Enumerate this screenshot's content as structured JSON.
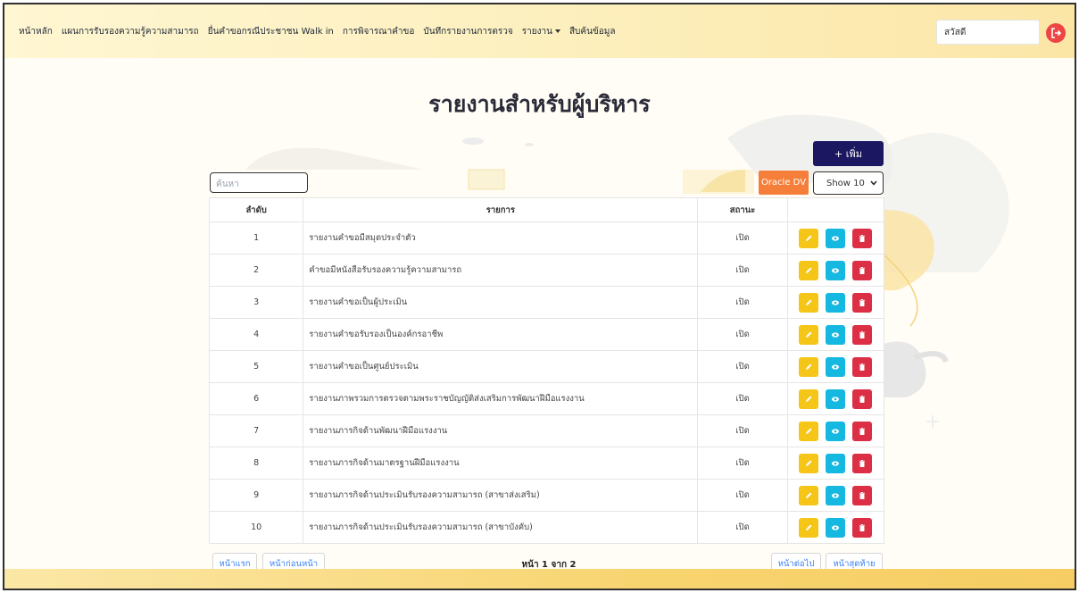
{
  "nav": {
    "items": [
      {
        "label": "หน้าหลัก"
      },
      {
        "label": "แผนการรับรองความรู้ความสามารถ"
      },
      {
        "label": "ยื่นคำขอกรณีประชาชน Walk in"
      },
      {
        "label": "การพิจารณาคำขอ"
      },
      {
        "label": "บันทึกรายงานการตรวจ"
      },
      {
        "label": "รายงาน"
      },
      {
        "label": "สืบค้นข้อมูล"
      }
    ],
    "greeting": "สวัสดี",
    "logout_icon": "logout-icon"
  },
  "page": {
    "title": "รายงานสำหรับผู้บริหาร"
  },
  "toolbar": {
    "add_label": "+ เพิ่ม",
    "oracle_label": "Oracle DV",
    "show_label": "Show 10",
    "search_placeholder": "ค้นหา"
  },
  "table": {
    "headers": {
      "num": "ลำดับ",
      "title": "รายการ",
      "status": "สถานะ",
      "actions": ""
    },
    "rows": [
      {
        "num": "1",
        "title": "รายงานคำขอมีสมุดประจำตัว",
        "status": "เปิด"
      },
      {
        "num": "2",
        "title": "คำขอมีหนังสือรับรองความรู้ความสามารถ",
        "status": "เปิด"
      },
      {
        "num": "3",
        "title": "รายงานคำขอเป็นผู้ประเมิน",
        "status": "เปิด"
      },
      {
        "num": "4",
        "title": "รายงานคำขอรับรองเป็นองค์กรอาชีพ",
        "status": "เปิด"
      },
      {
        "num": "5",
        "title": "รายงานคำขอเป็นศูนย์ประเมิน",
        "status": "เปิด"
      },
      {
        "num": "6",
        "title": "รายงานภาพรวมการตรวจตามพระราชบัญญัติส่งเสริมการพัฒนาฝีมือแรงงาน",
        "status": "เปิด"
      },
      {
        "num": "7",
        "title": "รายงานภารกิจด้านพัฒนาฝีมือแรงงาน",
        "status": "เปิด"
      },
      {
        "num": "8",
        "title": "รายงานภารกิจด้านมาตรฐานฝีมือแรงงาน",
        "status": "เปิด"
      },
      {
        "num": "9",
        "title": "รายงานภารกิจด้านประเมินรับรองความสามารถ (สาขาส่งเสริม)",
        "status": "เปิด"
      },
      {
        "num": "10",
        "title": "รายงานภารกิจด้านประเมินรับรองความสามารถ (สาขาบังคับ)",
        "status": "เปิด"
      }
    ]
  },
  "pagination": {
    "first": "หน้าแรก",
    "prev": "หน้าก่อนหน้า",
    "info": "หน้า 1 จาก 2",
    "next": "หน้าต่อไป",
    "last": "หน้าสุดท้าย"
  },
  "colors": {
    "add": "#1b1760",
    "oracle": "#f57f3a",
    "edit": "#f5c518",
    "view": "#14b8e0",
    "delete": "#dc2f45",
    "status": "#16a34a"
  }
}
